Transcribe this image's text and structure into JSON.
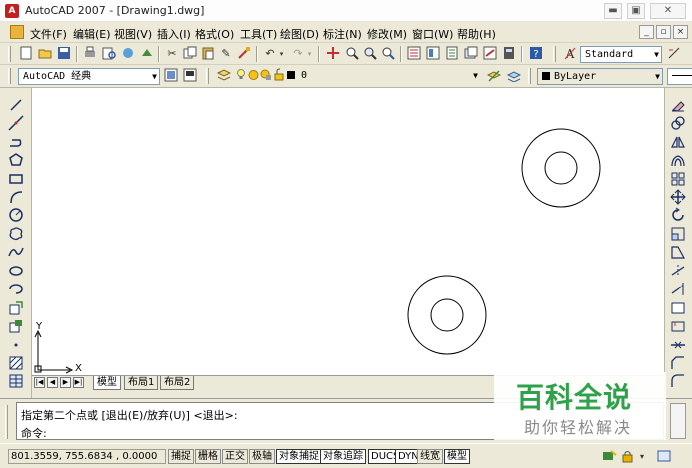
{
  "window": {
    "title": "AutoCAD 2007 - [Drawing1.dwg]",
    "controls": {
      "minimize": "▬",
      "maximize": "▣",
      "close": "✕"
    }
  },
  "menu": {
    "items": [
      "文件(F)",
      "编辑(E)",
      "视图(V)",
      "插入(I)",
      "格式(O)",
      "工具(T)",
      "绘图(D)",
      "标注(N)",
      "修改(M)",
      "窗口(W)",
      "帮助(H)"
    ],
    "doc_controls": [
      "_",
      "▫",
      "×"
    ]
  },
  "toolbar1": {
    "text_style": "Standard"
  },
  "toolbar2": {
    "workspace": "AutoCAD 经典",
    "layer": "0",
    "color": "ByLayer"
  },
  "canvas": {
    "ucs_y": "Y",
    "ucs_x": "X"
  },
  "layout_tabs": [
    "模型",
    "布局1",
    "布局2"
  ],
  "command": {
    "line1": "指定第二个点或 [退出(E)/放弃(U)] <退出>:",
    "line2": "命令:"
  },
  "status": {
    "coords": "801.3559,  755.6834 , 0.0000",
    "buttons": [
      {
        "label": "捕捉",
        "on": false
      },
      {
        "label": "栅格",
        "on": false
      },
      {
        "label": "正交",
        "on": false
      },
      {
        "label": "极轴",
        "on": false
      },
      {
        "label": "对象捕捉",
        "on": true
      },
      {
        "label": "对象追踪",
        "on": true
      },
      {
        "label": "DUCS",
        "on": true
      },
      {
        "label": "DYN",
        "on": true
      },
      {
        "label": "线宽",
        "on": false
      },
      {
        "label": "模型",
        "on": true
      }
    ]
  },
  "watermark": {
    "title": "百科全说",
    "subtitle": "助你轻松解决"
  },
  "icons": {
    "left_draw": [
      "line-icon",
      "construction-line-icon",
      "polyline-icon",
      "polygon-icon",
      "rectangle-icon",
      "arc-icon",
      "circle-icon",
      "revision-cloud-icon",
      "spline-icon",
      "ellipse-icon",
      "ellipse-arc-icon",
      "insert-block-icon",
      "make-block-icon",
      "point-icon",
      "hatch-icon",
      "table-icon"
    ],
    "right_modify": [
      "erase-icon",
      "copy-icon",
      "mirror-icon",
      "offset-icon",
      "array-icon",
      "move-icon",
      "rotate-icon",
      "scale-icon",
      "stretch-icon",
      "trim-icon",
      "extend-icon",
      "break-at-point-icon",
      "break-icon",
      "join-icon",
      "chamfer-icon",
      "fillet-icon"
    ]
  },
  "colors": {
    "accent_green": "#2fa14a",
    "ui_background": "#ece9d8"
  }
}
